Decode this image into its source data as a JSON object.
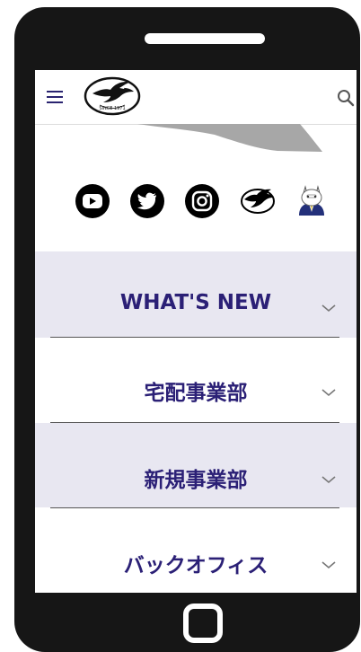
{
  "social": {
    "icons": [
      "youtube-icon",
      "twitter-icon",
      "instagram-icon",
      "logo-icon",
      "mascot-icon"
    ]
  },
  "sections": [
    {
      "label": "WHAT'S NEW",
      "expanded": false
    },
    {
      "label": "宅配事業部",
      "expanded": false
    },
    {
      "label": "新規事業部",
      "expanded": false
    },
    {
      "label": "バックオフィス",
      "expanded": false
    }
  ],
  "colors": {
    "accent": "#2b2076",
    "section_bg": "#e8e7f1",
    "phone_frame": "#161616"
  }
}
